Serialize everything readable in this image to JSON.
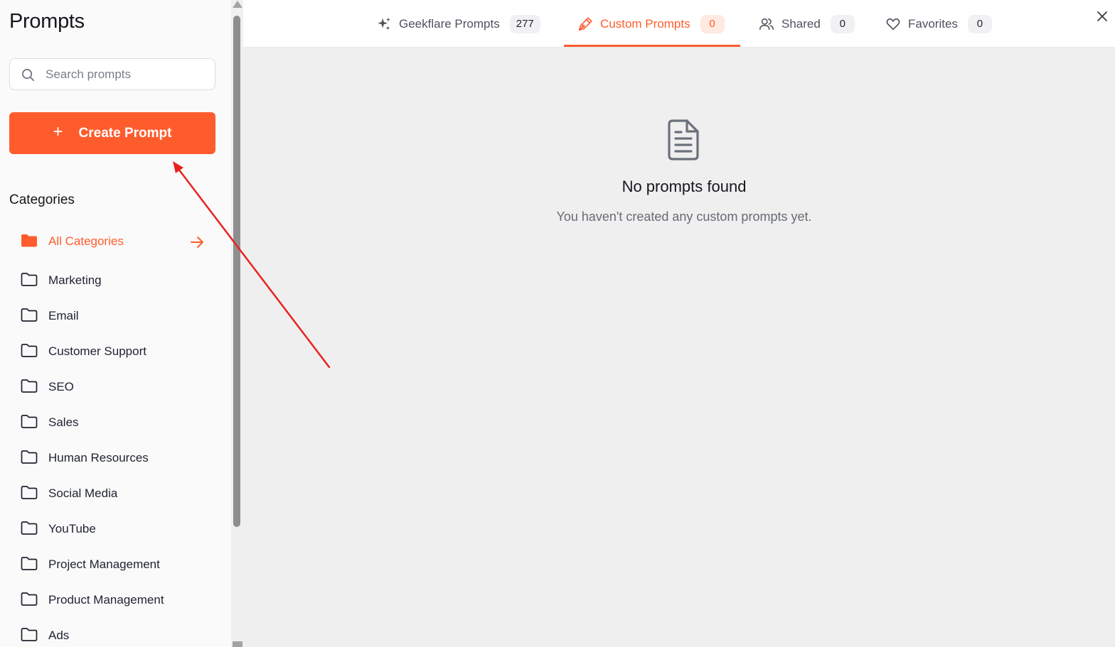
{
  "sidebar": {
    "title": "Prompts",
    "search": {
      "placeholder": "Search prompts",
      "value": ""
    },
    "create_button": {
      "icon": "plus-icon",
      "label": "Create Prompt"
    },
    "categories_heading": "Categories",
    "categories": [
      {
        "label": "All Categories",
        "active": true
      },
      {
        "label": "Marketing"
      },
      {
        "label": "Email"
      },
      {
        "label": "Customer Support"
      },
      {
        "label": "SEO"
      },
      {
        "label": "Sales"
      },
      {
        "label": "Human Resources"
      },
      {
        "label": "Social Media"
      },
      {
        "label": "YouTube"
      },
      {
        "label": "Project Management"
      },
      {
        "label": "Product Management"
      },
      {
        "label": "Ads"
      }
    ]
  },
  "tabs": [
    {
      "label": "Geekflare Prompts",
      "count": "277",
      "icon": "sparkles-icon"
    },
    {
      "label": "Custom Prompts",
      "count": "0",
      "icon": "pen-nib-icon",
      "active": true
    },
    {
      "label": "Shared",
      "count": "0",
      "icon": "users-icon"
    },
    {
      "label": "Favorites",
      "count": "0",
      "icon": "heart-icon"
    }
  ],
  "empty_state": {
    "icon": "document-icon",
    "title": "No prompts found",
    "message": "You haven't created any custom prompts yet."
  },
  "colors": {
    "accent": "#ff5c2d",
    "annotation_arrow": "#e8231e",
    "main_background": "#efefef",
    "sidebar_background": "#fafafa"
  }
}
